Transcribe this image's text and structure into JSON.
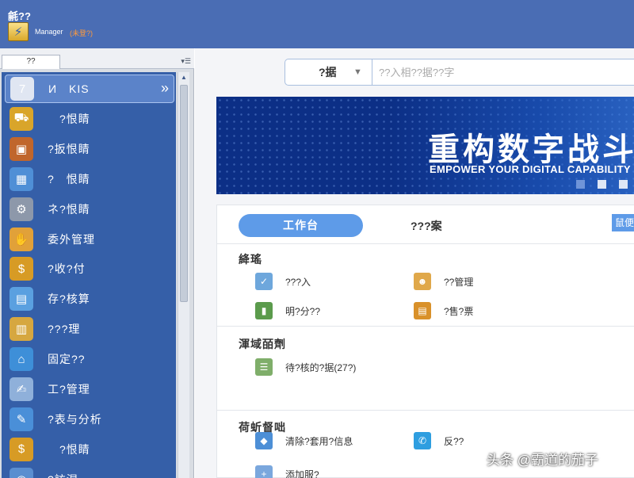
{
  "titlebar": {
    "title": "毹??",
    "manager_label": "Manager",
    "login_status": "(未登?)",
    "logo_glyph": "⚡"
  },
  "sidebar": {
    "tab_label": "??",
    "tab_menu_glyph": "▾☰",
    "scroll_up_glyph": "▲",
    "items": [
      {
        "label": "И　KIS",
        "icon": "kis-logo-icon",
        "glyph": "7",
        "color": "#e0e6f2",
        "active": true
      },
      {
        "label": "　?恨睛",
        "icon": "cart-person-icon",
        "glyph": "⛟",
        "color": "#d9a52a"
      },
      {
        "label": "?扳恨睛",
        "icon": "box-person-icon",
        "glyph": "▣",
        "color": "#c0662c"
      },
      {
        "label": "?　恨睛",
        "icon": "stock-boxes-icon",
        "glyph": "▦",
        "color": "#4f8fd6"
      },
      {
        "label": "ネ?恨睛",
        "icon": "factory-gear-icon",
        "glyph": "⚙",
        "color": "#8d98aa"
      },
      {
        "label": "委外管理",
        "icon": "handshake-icon",
        "glyph": "✋",
        "color": "#e1a139"
      },
      {
        "label": "?收?付",
        "icon": "money-bag-icon",
        "glyph": "$",
        "color": "#d79b25"
      },
      {
        "label": "存?核算",
        "icon": "inventory-calc-icon",
        "glyph": "▤",
        "color": "#5aa0e0"
      },
      {
        "label": "???理",
        "icon": "calculator-icon",
        "glyph": "▥",
        "color": "#d6a740"
      },
      {
        "label": "固定??",
        "icon": "fixed-asset-house-icon",
        "glyph": "⌂",
        "color": "#3e8fd8"
      },
      {
        "label": "工?管理",
        "icon": "payroll-hand-icon",
        "glyph": "✍",
        "color": "#8fb0da"
      },
      {
        "label": "?表与分析",
        "icon": "report-chart-icon",
        "glyph": "✎",
        "color": "#4a8fd8"
      },
      {
        "label": "　?恨睛",
        "icon": "money-person-icon",
        "glyph": "$",
        "color": "#d79b25"
      },
      {
        "label": "?訪涅",
        "icon": "settings-globe-icon",
        "glyph": "◉",
        "color": "#5a8ed0"
      }
    ]
  },
  "search": {
    "type_value": "?据",
    "type_arrow": "▼",
    "placeholder": "??入相??据??字"
  },
  "banner": {
    "headline": "重构数字战斗力",
    "subline": "EMPOWER YOUR DIGITAL CAPABILITY",
    "slide_count": 3,
    "active_slide": 1
  },
  "panel": {
    "tabs": [
      {
        "label": "工作台",
        "active": true
      },
      {
        "label": "???案",
        "active": false
      }
    ],
    "edge_button_label": "鼠便",
    "sections": [
      {
        "title": "絳瑤",
        "entries": [
          {
            "label": "???入",
            "icon": "bag-entry-icon",
            "glyph": "✓",
            "color": "#6ea7dc"
          },
          {
            "label": "??管理",
            "icon": "person-manage-icon",
            "glyph": "☻",
            "color": "#e0a84a"
          },
          {
            "label": "明?分??",
            "icon": "bar-chart-icon",
            "glyph": "▮",
            "color": "#5b9b4c"
          },
          {
            "label": "?售?票",
            "icon": "sales-invoice-icon",
            "glyph": "▤",
            "color": "#d9912a"
          }
        ]
      },
      {
        "title": "渾域皕劑",
        "entries": [
          {
            "label": "待?核的?据(27?)",
            "icon": "pending-list-icon",
            "glyph": "☰",
            "color": "#7fae6a"
          }
        ]
      },
      {
        "title": "荷蚚督咄",
        "entries": [
          {
            "label": "清除?套用?信息",
            "icon": "clear-diamond-icon",
            "glyph": "◆",
            "color": "#4d8fd6"
          },
          {
            "label": "反??",
            "icon": "feedback-icon",
            "glyph": "✆",
            "color": "#2e9ee0"
          },
          {
            "label": "添加服?",
            "icon": "add-icon",
            "glyph": "+",
            "color": "#7aa7dd"
          }
        ]
      }
    ]
  },
  "watermark": "头条 @霸道的茄子"
}
